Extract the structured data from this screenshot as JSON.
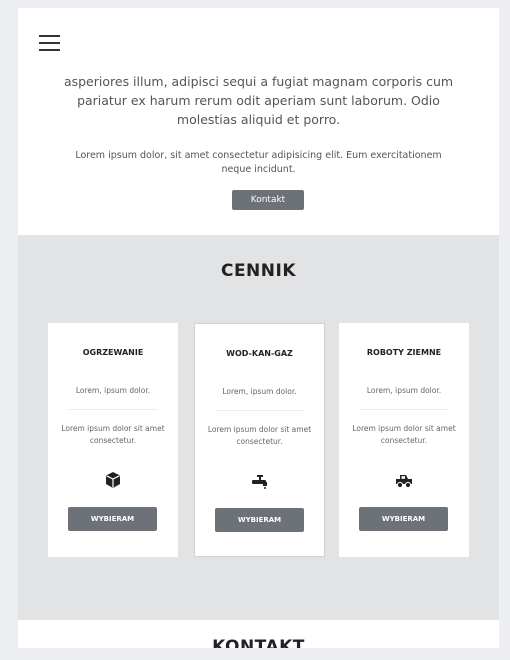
{
  "header": {
    "menu_icon": "hamburger-menu-icon"
  },
  "intro": {
    "paragraph": "asperiores illum, adipisci sequi a fugiat magnam corporis cum pariatur ex harum rerum odit aperiam sunt laborum. Odio molestias aliquid et porro.",
    "small_text": "Lorem ipsum dolor, sit amet consectetur adipisicing elit. Eum exercitationem neque incidunt.",
    "button_label": "Kontakt"
  },
  "pricing": {
    "title": "CENNIK",
    "cards": [
      {
        "title": "OGRZEWANIE",
        "line1": "Lorem, ipsum dolor.",
        "line2": "Lorem ipsum dolor sit amet consectetur.",
        "icon": "box-icon",
        "button_label": "WYBIERAM"
      },
      {
        "title": "WOD-KAN-GAZ",
        "line1": "Lorem, ipsum dolor.",
        "line2": "Lorem ipsum dolor sit amet consectetur.",
        "icon": "faucet-icon",
        "button_label": "WYBIERAM"
      },
      {
        "title": "ROBOTY ZIEMNE",
        "line1": "Lorem, ipsum dolor.",
        "line2": "Lorem ipsum dolor sit amet consectetur.",
        "icon": "truck-icon",
        "button_label": "WYBIERAM"
      }
    ]
  },
  "contact": {
    "title": "KONTAKT"
  }
}
